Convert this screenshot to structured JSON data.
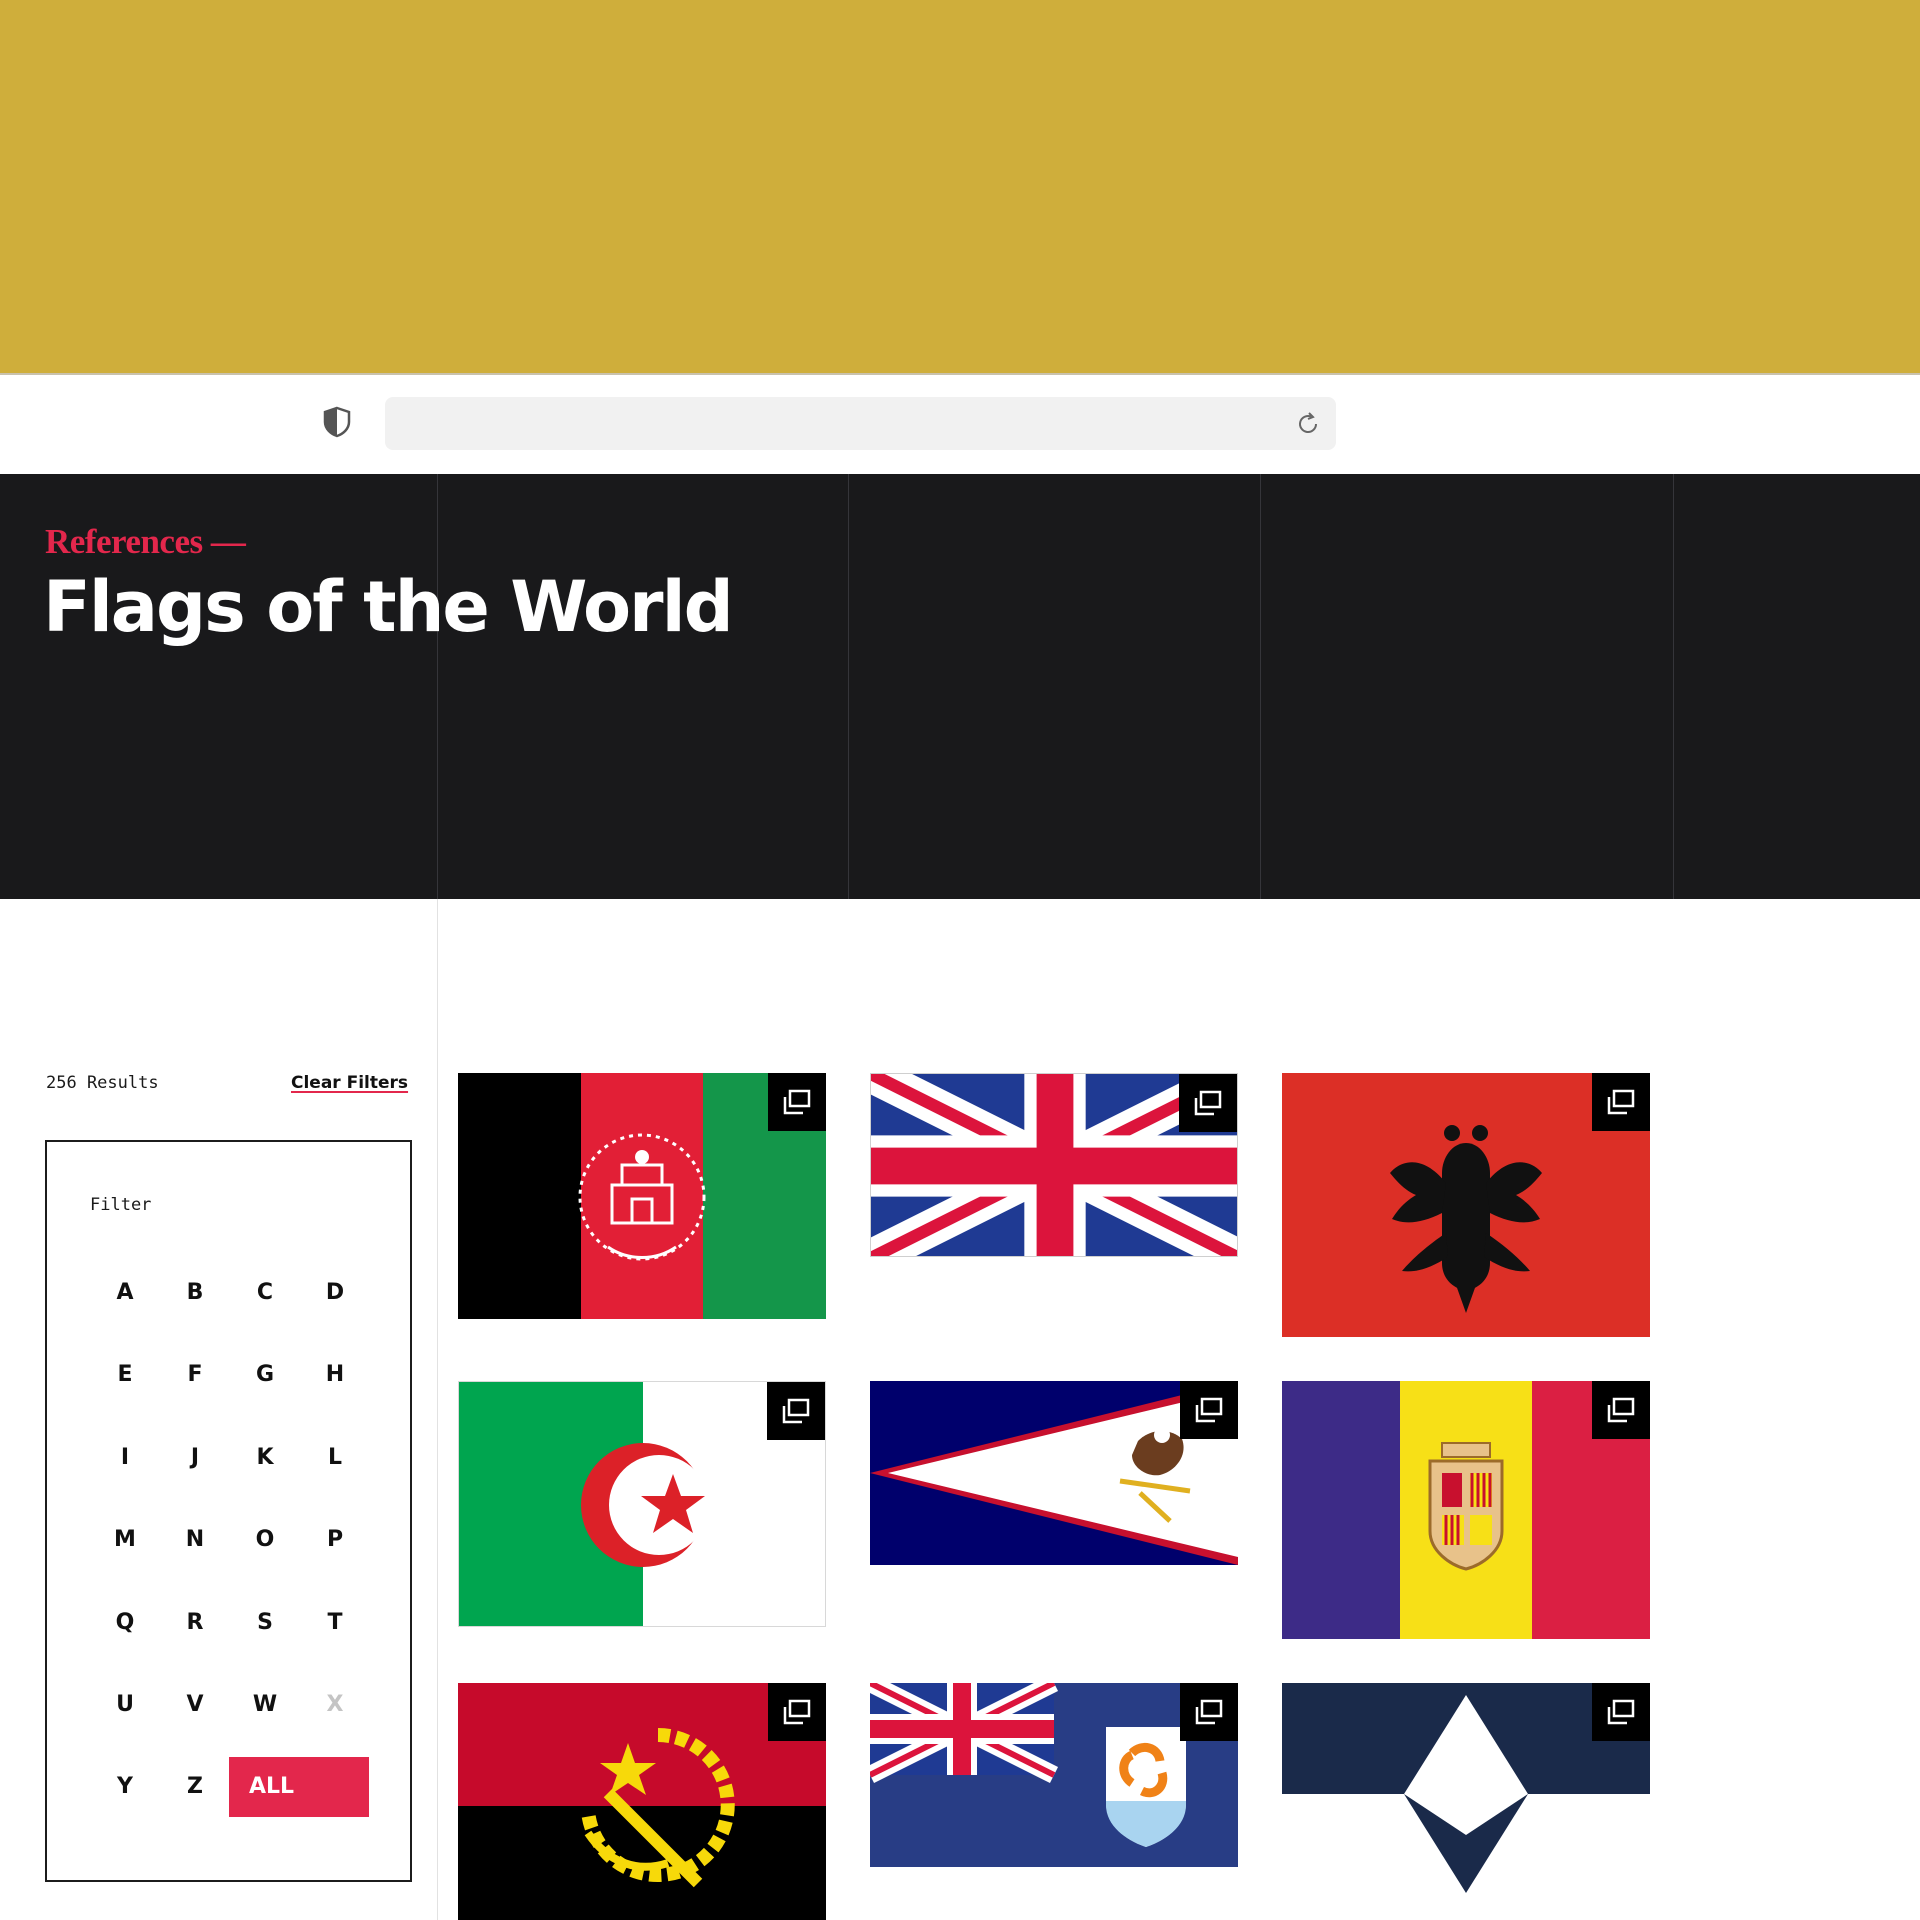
{
  "browser": {
    "shield_icon": "shield-icon",
    "reload_icon": "reload-icon"
  },
  "header": {
    "eyebrow": "References —",
    "title": "Flags of the World"
  },
  "sidebar": {
    "results_count": "256 Results",
    "clear_filters_label": "Clear Filters",
    "filter_label": "Filter",
    "letters": [
      "A",
      "B",
      "C",
      "D",
      "E",
      "F",
      "G",
      "H",
      "I",
      "J",
      "K",
      "L",
      "M",
      "N",
      "O",
      "P",
      "Q",
      "R",
      "S",
      "T",
      "U",
      "V",
      "W",
      "X",
      "Y",
      "Z"
    ],
    "disabled_letters": [
      "X"
    ],
    "all_label": "ALL"
  },
  "grid": {
    "expand_icon": "expand-icon",
    "flags": [
      {
        "name": "flag-afghanistan",
        "colors": [
          "#000000",
          "#e21f36",
          "#14964a"
        ]
      },
      {
        "name": "flag-united-kingdom",
        "colors": [
          "#1f3a93",
          "#ffffff",
          "#dc143c"
        ]
      },
      {
        "name": "flag-albania",
        "colors": [
          "#dc2f26",
          "#111111"
        ]
      },
      {
        "name": "flag-algeria",
        "colors": [
          "#00a54f",
          "#ffffff",
          "#dc2128"
        ]
      },
      {
        "name": "flag-american-samoa",
        "colors": [
          "#00006c",
          "#ffffff",
          "#c7102e"
        ]
      },
      {
        "name": "flag-andorra",
        "colors": [
          "#3d2b87",
          "#f7e017",
          "#db1f43"
        ]
      },
      {
        "name": "flag-angola",
        "colors": [
          "#c60a2b",
          "#000000",
          "#f7d90a"
        ]
      },
      {
        "name": "flag-anguilla",
        "colors": [
          "#283d85",
          "#ffffff",
          "#f08217"
        ]
      },
      {
        "name": "flag-antarctica",
        "colors": [
          "#1a2a4a",
          "#ffffff"
        ]
      }
    ]
  }
}
